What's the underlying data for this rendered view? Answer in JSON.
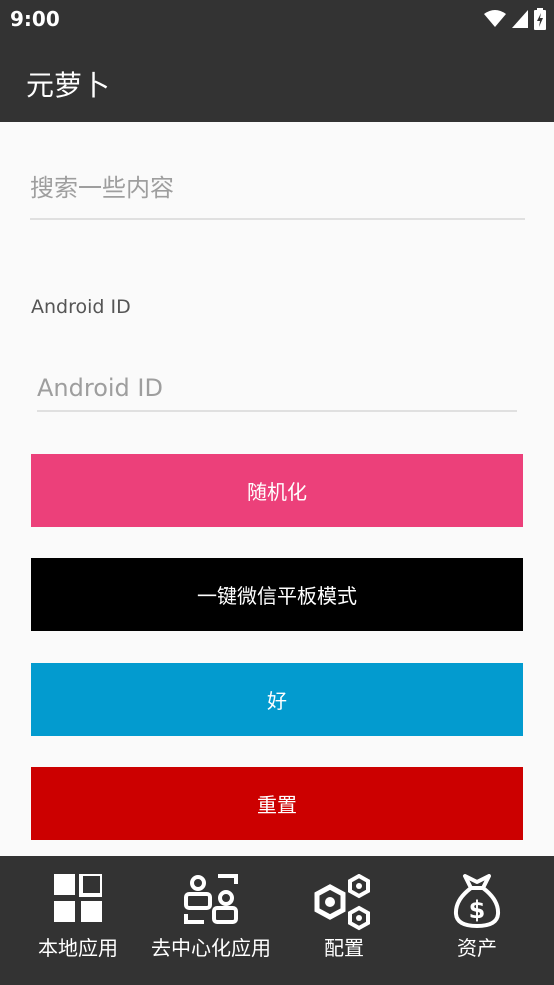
{
  "status_bar": {
    "time": "9:00",
    "icons": [
      "wifi-icon",
      "signal-icon",
      "battery-icon"
    ]
  },
  "app_bar": {
    "title": "元萝卜"
  },
  "search": {
    "placeholder": "搜索一些内容"
  },
  "android_id": {
    "label": "Android ID",
    "placeholder": "Android ID"
  },
  "buttons": {
    "randomize": {
      "label": "随机化",
      "color": "#ec407a"
    },
    "wechat_tablet": {
      "label": "一键微信平板模式",
      "color": "#000000"
    },
    "ok": {
      "label": "好",
      "color": "#039bcf"
    },
    "reset": {
      "label": "重置",
      "color": "#cc0000"
    }
  },
  "bottom_nav": {
    "items": [
      {
        "label": "本地应用",
        "icon": "grid-icon"
      },
      {
        "label": "去中心化应用",
        "icon": "dapp-icon"
      },
      {
        "label": "配置",
        "icon": "hexagons-icon"
      },
      {
        "label": "资产",
        "icon": "money-bag-icon"
      }
    ]
  },
  "colors": {
    "bar_background": "#333333",
    "page_background": "#fafafa"
  }
}
